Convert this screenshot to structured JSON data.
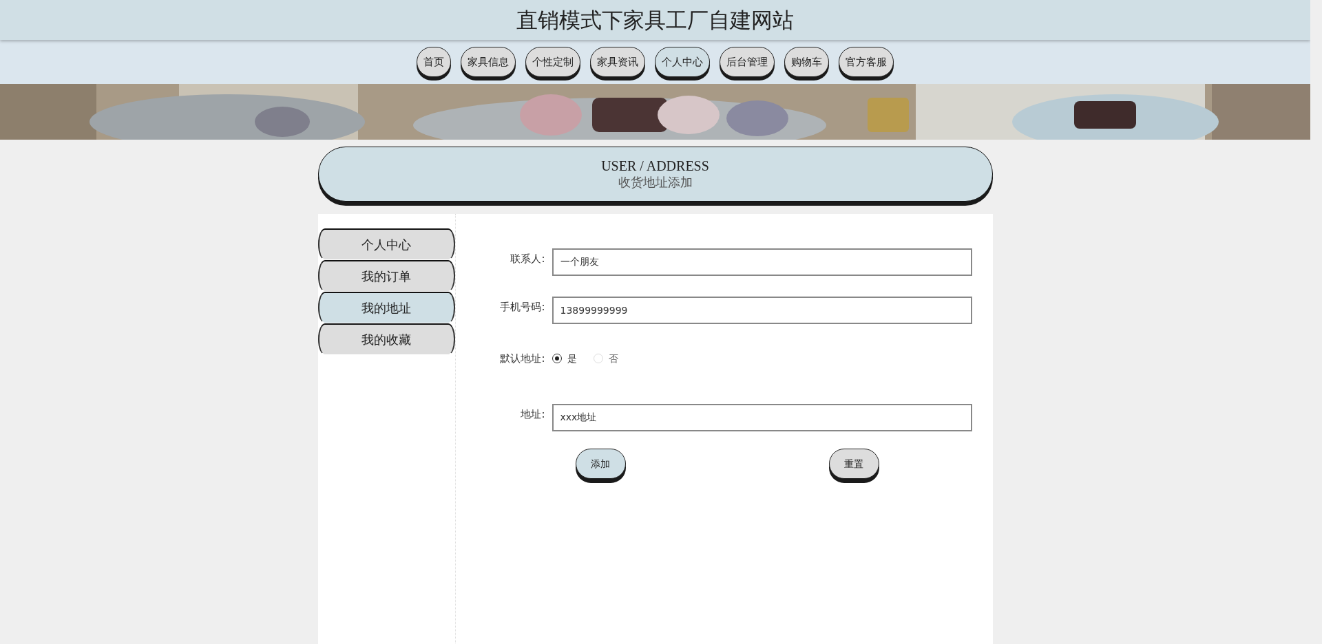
{
  "site_title": "直销模式下家具工厂自建网站",
  "nav": [
    {
      "label": "首页",
      "selected": false
    },
    {
      "label": "家具信息",
      "selected": false
    },
    {
      "label": "个性定制",
      "selected": false
    },
    {
      "label": "家具资讯",
      "selected": false
    },
    {
      "label": "个人中心",
      "selected": true
    },
    {
      "label": "后台管理",
      "selected": false
    },
    {
      "label": "购物车",
      "selected": false
    },
    {
      "label": "官方客服",
      "selected": false
    }
  ],
  "page_heading": {
    "title": "USER / ADDRESS",
    "subtitle": "收货地址添加"
  },
  "sidebar": {
    "items": [
      {
        "label": "个人中心",
        "selected": false
      },
      {
        "label": "我的订单",
        "selected": false
      },
      {
        "label": "我的地址",
        "selected": true
      },
      {
        "label": "我的收藏",
        "selected": false
      }
    ]
  },
  "form": {
    "fields": [
      {
        "kind": "text",
        "label": "联系人:",
        "value": "一个朋友"
      },
      {
        "kind": "text",
        "label": "手机号码:",
        "value": "13899999999"
      },
      {
        "kind": "radio",
        "label": "默认地址:",
        "options": [
          {
            "label": "是",
            "selected": true
          },
          {
            "label": "否",
            "selected": false
          }
        ]
      },
      {
        "kind": "text",
        "label": "地址:",
        "value": "xxx地址"
      }
    ],
    "buttons": [
      {
        "label": "添加",
        "kind": "primary"
      },
      {
        "label": "重置",
        "kind": "secondary"
      }
    ]
  }
}
